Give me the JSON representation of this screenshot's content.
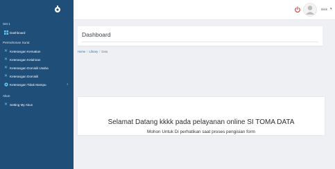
{
  "sidebar": {
    "sections": {
      "set": "Set 1",
      "permohonan": "Permohonan Surat",
      "akun": "Akun"
    },
    "items": [
      {
        "label": "Dashboard",
        "icon": "dashboard-icon"
      },
      {
        "label": "Keterangan Kematian",
        "icon": "x-icon"
      },
      {
        "label": "Keterangan Kelahiran",
        "icon": "x-icon"
      },
      {
        "label": "Keterangan Domisili Usaha",
        "icon": "x-icon"
      },
      {
        "label": "Keterangan Domisili",
        "icon": "x-icon"
      },
      {
        "label": "Keterangan Tidak Mampu",
        "icon": "gear-icon"
      },
      {
        "label": "Setting My Akun",
        "icon": "x-icon"
      }
    ],
    "accent_color": "#1f4e79"
  },
  "topbar": {
    "user_name": "kkkk"
  },
  "header": {
    "title": "Dashboard"
  },
  "breadcrumb": {
    "home": "Home",
    "sep1": "/",
    "library": "Library",
    "sep2": "/",
    "current": "Data"
  },
  "main": {
    "welcome": "Selamat Datang kkkk pada pelayanan online SI TOMA DATA",
    "subtext": "Mohon Untuk Di perhatikan saat proses pengisian form"
  }
}
